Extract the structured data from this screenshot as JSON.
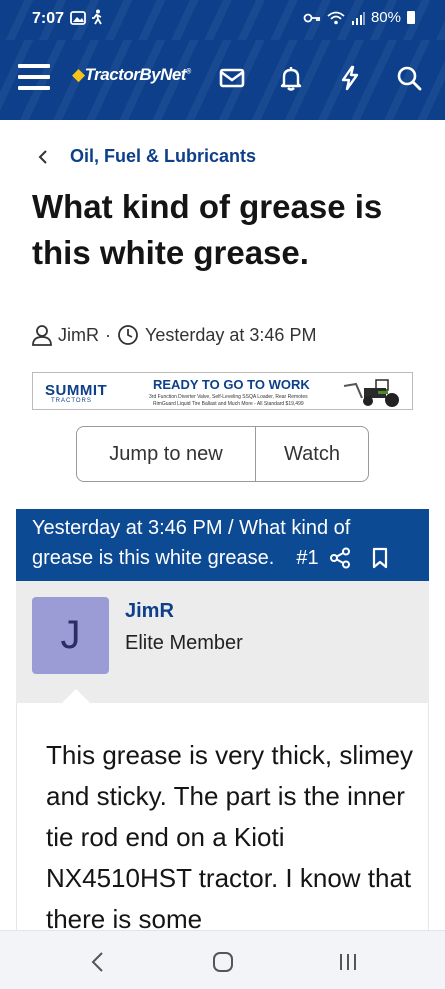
{
  "status_bar": {
    "time": "7:07",
    "battery": "80%",
    "icons": [
      "image-icon",
      "walk-icon",
      "key-icon",
      "wifi-icon",
      "signal-icon",
      "battery-icon"
    ]
  },
  "header": {
    "logo_text": "TractorByNet",
    "icons": [
      "menu-icon",
      "mail-icon",
      "bell-icon",
      "lightning-icon",
      "search-icon"
    ],
    "brand_color": "#0d3f8a"
  },
  "breadcrumb": {
    "label": "Oil, Fuel & Lubricants"
  },
  "thread": {
    "title": "What kind of grease is this white grease.",
    "author": "JimR",
    "separator": "·",
    "time": "Yesterday at 3:46 PM"
  },
  "ad": {
    "brand": "SUMMIT",
    "brand_sub": "TRACTORS",
    "headline": "READY TO GO TO WORK",
    "fine_line1": "3rd Function Diverter Valve, Self-Leveling SSQA Loader, Rear Remotes",
    "fine_line2": "RimGuard Liquid Tire Ballast and Much More - All Standard $19,499"
  },
  "actions": {
    "jump_label": "Jump to new",
    "watch_label": "Watch"
  },
  "post": {
    "header_line1": "Yesterday at 3:46 PM / What kind of",
    "header_line2": "grease is this white grease.",
    "number": "#1",
    "avatar_letter": "J",
    "username": "JimR",
    "user_title": "Elite Member",
    "body": "This grease is very thick, slimey and sticky. The part is the inner tie rod end on a Kioti NX4510HST tractor. I know that there is some"
  }
}
